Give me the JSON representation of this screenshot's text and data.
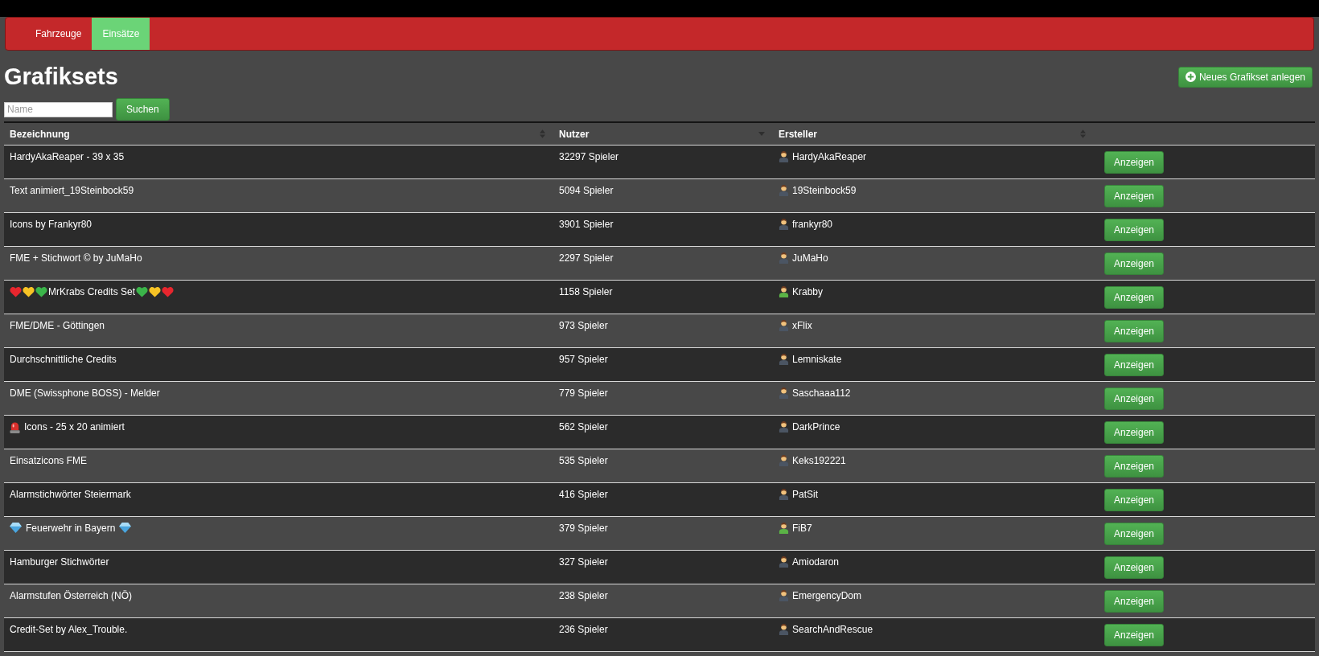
{
  "nav": {
    "tabs": [
      {
        "label": "Fahrzeuge",
        "selected": false
      },
      {
        "label": "Einsätze",
        "selected": true
      }
    ]
  },
  "header": {
    "title": "Grafiksets",
    "new_button": "Neues Grafikset anlegen"
  },
  "search": {
    "placeholder": "Name",
    "button": "Suchen"
  },
  "table": {
    "columns": [
      {
        "label": "Bezeichnung",
        "sorted_descending": false
      },
      {
        "label": "Nutzer",
        "sorted_descending": true
      },
      {
        "label": "Ersteller",
        "sorted_descending": false
      }
    ],
    "rows": [
      {
        "name": {
          "text": "HardyAkaReaper - 39 x 35"
        },
        "users": "32297 Spieler",
        "creator": {
          "name": "HardyAkaReaper",
          "color": "#4b5563"
        },
        "button": "Anzeigen"
      },
      {
        "name": {
          "text": "Text animiert_19Steinbock59"
        },
        "users": "5094 Spieler",
        "creator": {
          "name": "19Steinbock59",
          "color": "#4b5563"
        },
        "button": "Anzeigen"
      },
      {
        "name": {
          "text": "Icons by Frankyr80"
        },
        "users": "3901 Spieler",
        "creator": {
          "name": "frankyr80",
          "color": "#4b5563"
        },
        "button": "Anzeigen"
      },
      {
        "name": {
          "text": "FME + Stichwort © by JuMaHo"
        },
        "users": "2297 Spieler",
        "creator": {
          "name": "JuMaHo",
          "color": "#4b5563"
        },
        "button": "Anzeigen"
      },
      {
        "name": {
          "text": "MrKrabs Credits Set",
          "icons_before": [
            {
              "kind": "heart",
              "color": "#e8262e"
            },
            {
              "kind": "heart",
              "color": "#f7c325"
            },
            {
              "kind": "heart",
              "color": "#3bb54a"
            }
          ],
          "icons_after": [
            {
              "kind": "heart",
              "color": "#3bb54a"
            },
            {
              "kind": "heart",
              "color": "#f7c325"
            },
            {
              "kind": "heart",
              "color": "#e8262e"
            }
          ]
        },
        "users": "1158 Spieler",
        "creator": {
          "name": "Krabby",
          "color": "#5bb346"
        },
        "button": "Anzeigen"
      },
      {
        "name": {
          "text": "FME/DME - Göttingen"
        },
        "users": "973 Spieler",
        "creator": {
          "name": "xFlix",
          "color": "#4b5563"
        },
        "button": "Anzeigen"
      },
      {
        "name": {
          "text": "Durchschnittliche Credits"
        },
        "users": "957 Spieler",
        "creator": {
          "name": "Lemniskate",
          "color": "#4b5563"
        },
        "button": "Anzeigen"
      },
      {
        "name": {
          "text": "DME (Swissphone BOSS) - Melder"
        },
        "users": "779 Spieler",
        "creator": {
          "name": "Saschaaa112",
          "color": "#4b5563"
        },
        "button": "Anzeigen"
      },
      {
        "name": {
          "text": "Icons - 25 x 20 animiert",
          "icons_before": [
            {
              "kind": "siren"
            }
          ]
        },
        "users": "562 Spieler",
        "creator": {
          "name": "DarkPrince",
          "color": "#4b5563"
        },
        "button": "Anzeigen"
      },
      {
        "name": {
          "text": "Einsatzicons FME"
        },
        "users": "535 Spieler",
        "creator": {
          "name": "Keks192221",
          "color": "#4b5563"
        },
        "button": "Anzeigen"
      },
      {
        "name": {
          "text": "Alarmstichwörter Steiermark"
        },
        "users": "416 Spieler",
        "creator": {
          "name": "PatSit",
          "color": "#4b5563"
        },
        "button": "Anzeigen"
      },
      {
        "name": {
          "text": "Feuerwehr in Bayern",
          "icons_before": [
            {
              "kind": "gem"
            }
          ],
          "icons_after": [
            {
              "kind": "gem"
            }
          ]
        },
        "users": "379 Spieler",
        "creator": {
          "name": "FiB7",
          "color": "#5bb346"
        },
        "button": "Anzeigen"
      },
      {
        "name": {
          "text": "Hamburger Stichwörter"
        },
        "users": "327 Spieler",
        "creator": {
          "name": "Amiodaron",
          "color": "#4b5563"
        },
        "button": "Anzeigen"
      },
      {
        "name": {
          "text": "Alarmstufen Österreich (NÖ)"
        },
        "users": "238 Spieler",
        "creator": {
          "name": "EmergencyDom",
          "color": "#4b5563"
        },
        "button": "Anzeigen"
      },
      {
        "name": {
          "text": "Credit-Set by Alex_Trouble."
        },
        "users": "236 Spieler",
        "creator": {
          "name": "SearchAndRescue",
          "color": "#4b5563"
        },
        "button": "Anzeigen"
      }
    ]
  }
}
